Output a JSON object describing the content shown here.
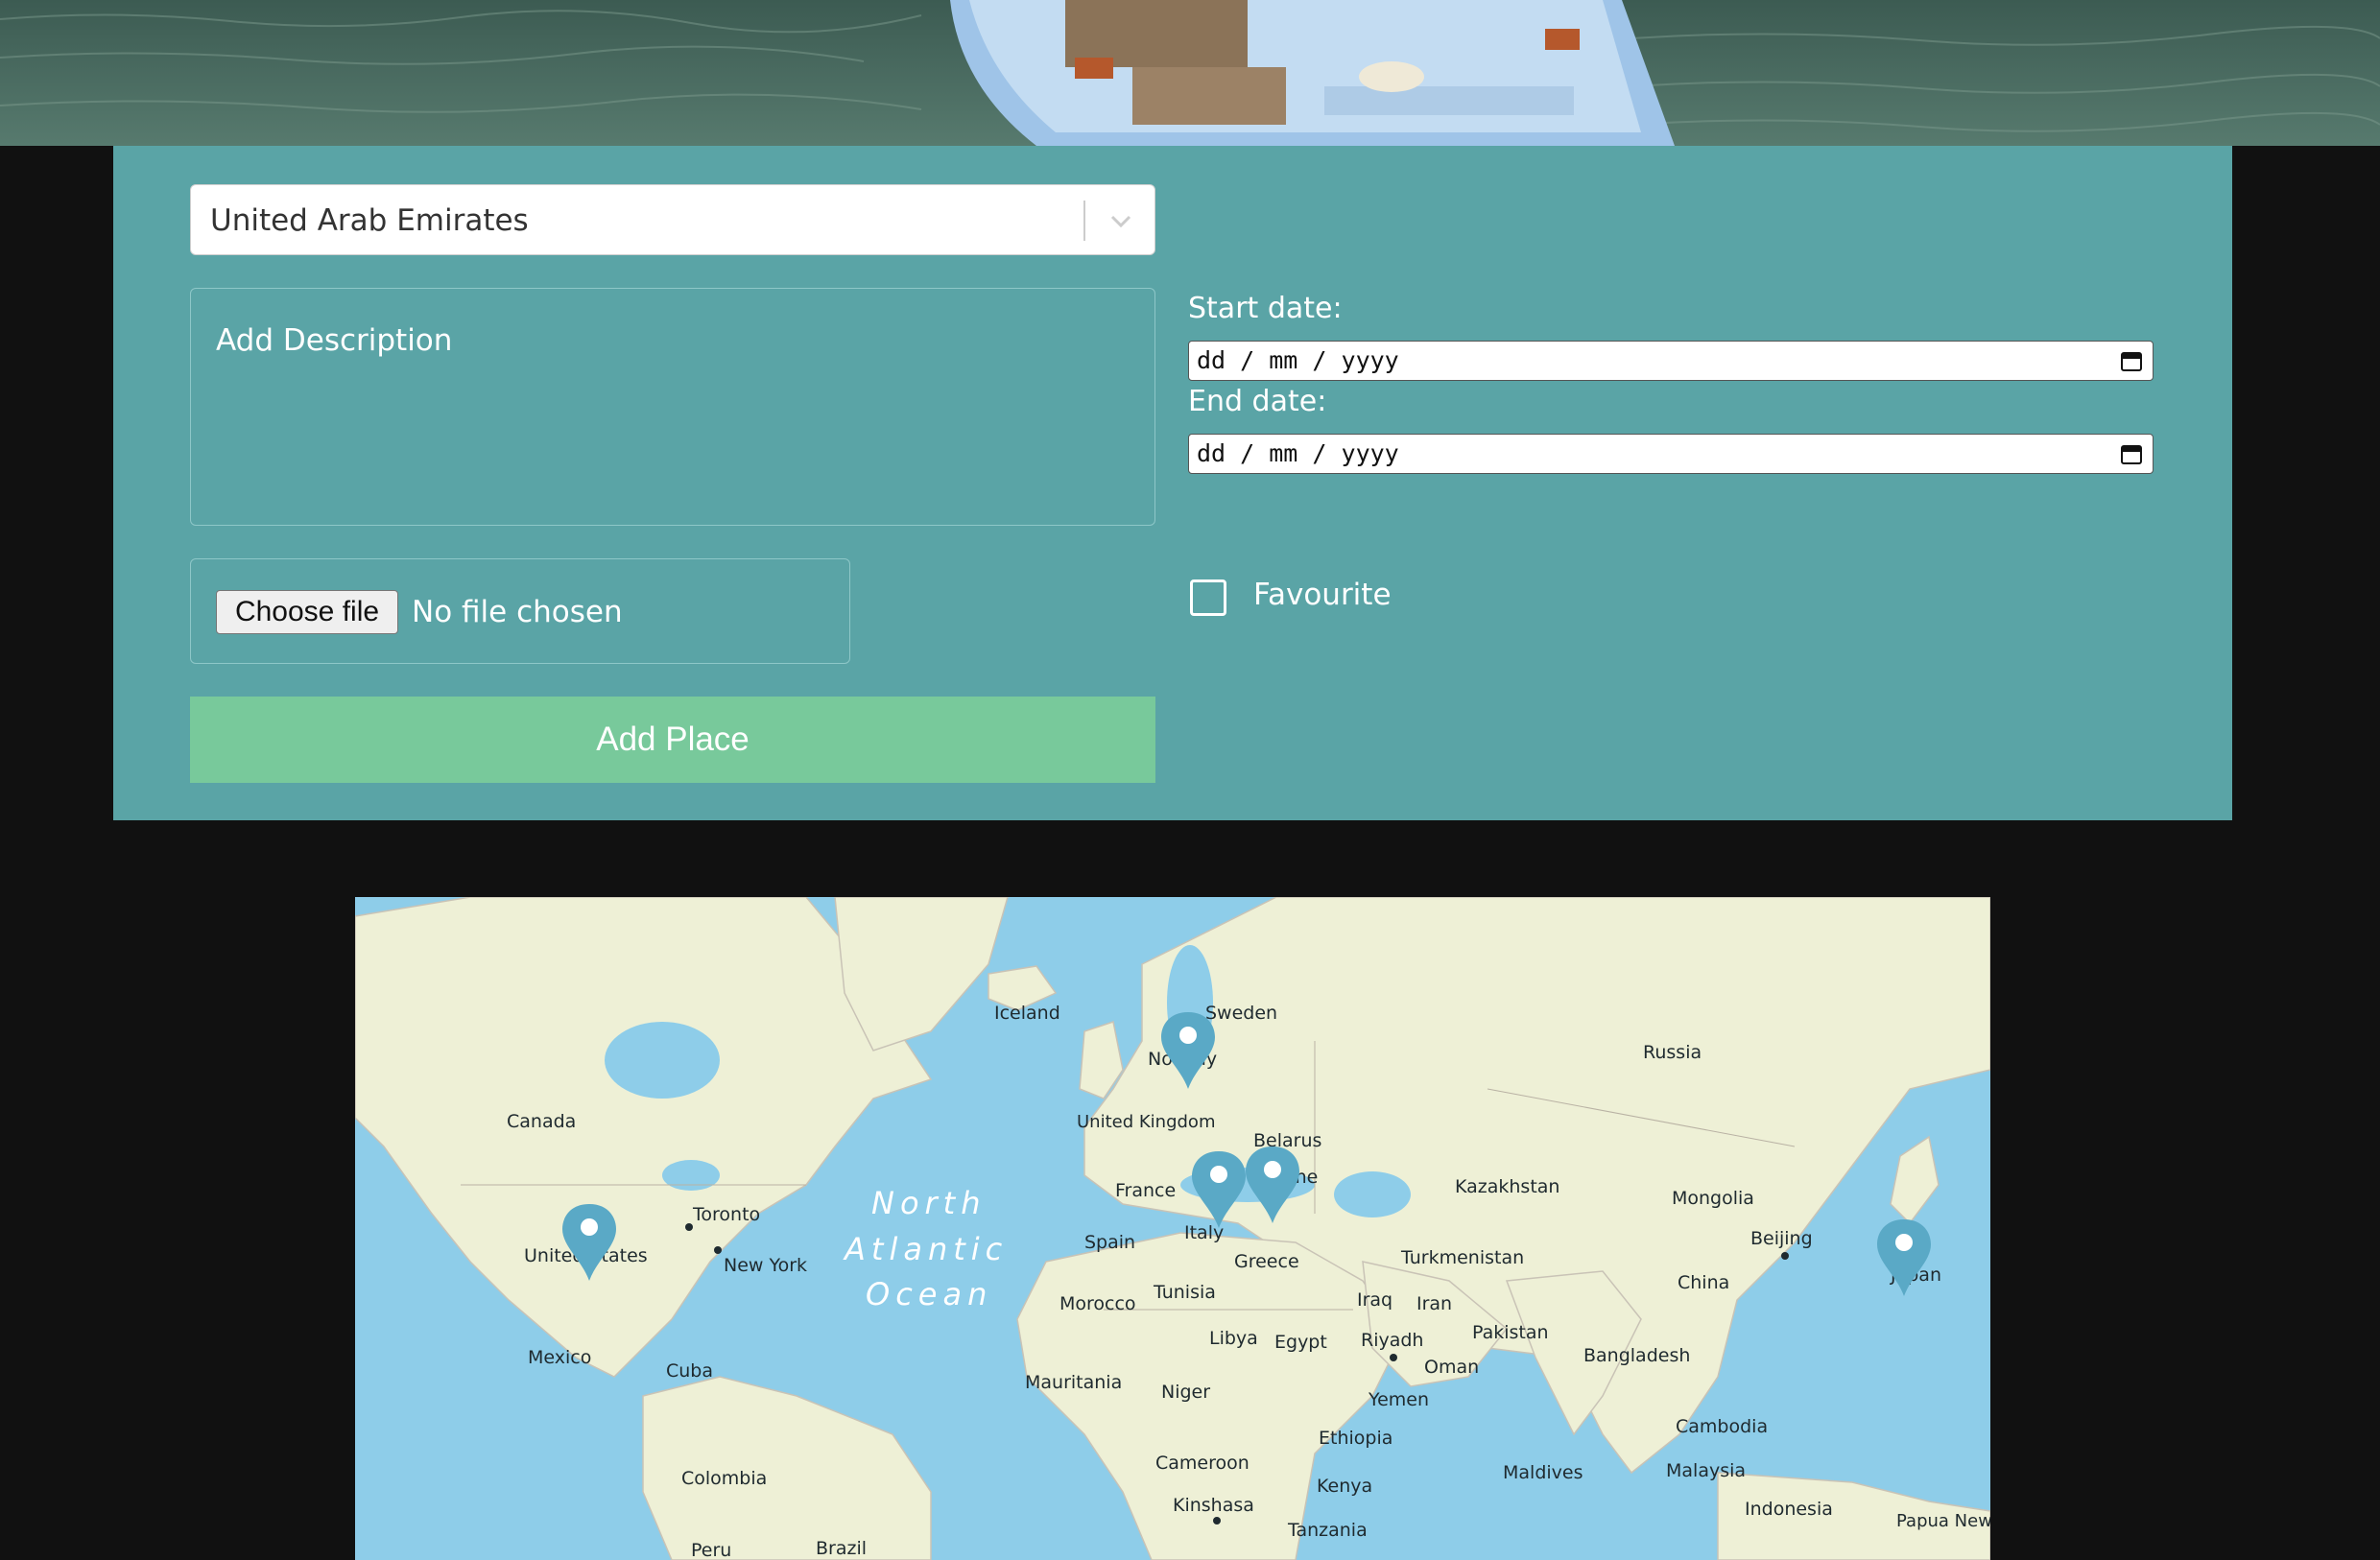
{
  "form": {
    "country_value": "United Arab Emirates",
    "description_placeholder": "Add Description",
    "file_button_label": "Choose file",
    "file_status": "No file chosen",
    "submit_label": "Add Place",
    "start_date_label": "Start date:",
    "end_date_label": "End date:",
    "date_format": "dd / mm / yyyy",
    "favourite_label": "Favourite",
    "favourite_checked": false
  },
  "colors": {
    "panel": "#5aa4a6",
    "submit": "#78c99b",
    "page_background": "#111111",
    "marker": "#5aa9c6",
    "water": "#8ecde9",
    "land": "#eef0d6"
  },
  "map": {
    "labels": [
      "Iceland",
      "Sweden",
      "Norway",
      "Russia",
      "Canada",
      "United Kingdom",
      "Belarus",
      "Ukraine",
      "France",
      "Kazakhstan",
      "Mongolia",
      "Toronto",
      "New York",
      "United States",
      "Spain",
      "Italy",
      "Greece",
      "Turkmenistan",
      "Beijing",
      "Japan",
      "China",
      "Morocco",
      "Tunisia",
      "Iraq",
      "Iran",
      "Pakistan",
      "Libya",
      "Egypt",
      "Riyadh",
      "Oman",
      "Bangladesh",
      "Mexico",
      "Cuba",
      "Mauritania",
      "Niger",
      "Yemen",
      "Ethiopia",
      "Cambodia",
      "Cameroon",
      "Maldives",
      "Malaysia",
      "Kenya",
      "Kinshasa",
      "Indonesia",
      "Tanzania",
      "Colombia",
      "Papua New Guinea",
      "Peru",
      "Brazil"
    ],
    "ocean_label": [
      "North",
      "Atlantic",
      "Ocean"
    ],
    "markers": [
      "Norway",
      "Italy",
      "Serbia",
      "United States",
      "Japan"
    ]
  }
}
